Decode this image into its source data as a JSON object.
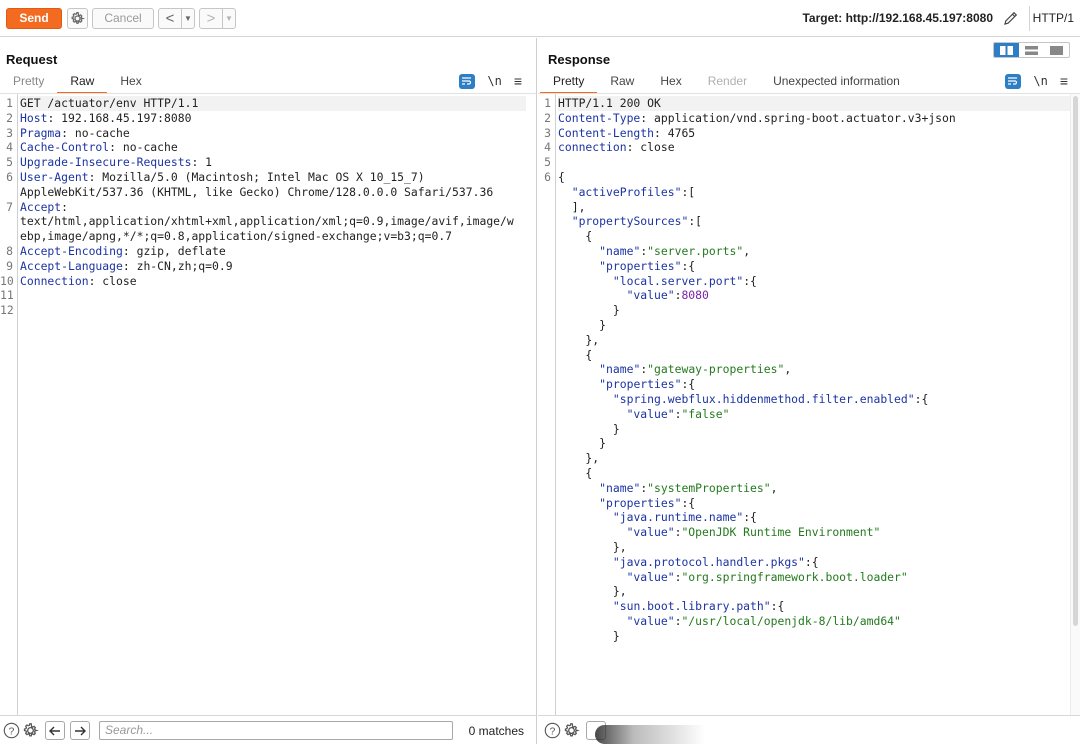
{
  "toolbar": {
    "send_label": "Send",
    "cancel_label": "Cancel",
    "target_label": "Target: http://192.168.45.197:8080",
    "protocol": "HTTP/1",
    "accent_color": "#f26b21"
  },
  "request": {
    "title": "Request",
    "tabs": [
      "Pretty",
      "Raw",
      "Hex"
    ],
    "active_tab": "Raw",
    "search_placeholder": "Search...",
    "matches": "0 matches"
  },
  "response": {
    "title": "Response",
    "tabs": [
      "Pretty",
      "Raw",
      "Hex",
      "Render",
      "Unexpected information"
    ],
    "active_tab": "Pretty"
  },
  "icons": {
    "wrap": "wrap-lines-icon",
    "newline": "\\n",
    "menu": "≡",
    "help": "help-icon",
    "settings": "gear-icon"
  },
  "request_lines": [
    {
      "n": "1",
      "t": "GET /actuator/env HTTP/1.1"
    },
    {
      "n": "2",
      "k": "Host",
      "v": " 192.168.45.197:8080"
    },
    {
      "n": "3",
      "k": "Pragma",
      "v": " no-cache"
    },
    {
      "n": "4",
      "k": "Cache-Control",
      "v": " no-cache"
    },
    {
      "n": "5",
      "k": "Upgrade-Insecure-Requests",
      "v": " 1"
    },
    {
      "n": "6",
      "k": "User-Agent",
      "v": " Mozilla/5.0 (Macintosh; Intel Mac OS X 10_15_7)"
    },
    {
      "n": "",
      "t": "AppleWebKit/537.36 (KHTML, like Gecko) Chrome/128.0.0.0 Safari/537.36"
    },
    {
      "n": "7",
      "k": "Accept",
      "v": ""
    },
    {
      "n": "",
      "t": "text/html,application/xhtml+xml,application/xml;q=0.9,image/avif,image/w"
    },
    {
      "n": "",
      "t": "ebp,image/apng,*/*;q=0.8,application/signed-exchange;v=b3;q=0.7"
    },
    {
      "n": "8",
      "k": "Accept-Encoding",
      "v": " gzip, deflate"
    },
    {
      "n": "9",
      "k": "Accept-Language",
      "v": " zh-CN,zh;q=0.9"
    },
    {
      "n": "10",
      "k": "Connection",
      "v": " close"
    },
    {
      "n": "11",
      "t": ""
    },
    {
      "n": "12",
      "t": ""
    }
  ],
  "response_lines": [
    {
      "n": "1",
      "parts": [
        {
          "c": "pl",
          "s": "HTTP/1.1 200 OK"
        }
      ]
    },
    {
      "n": "2",
      "parts": [
        {
          "c": "hk",
          "s": "Content-Type"
        },
        {
          "c": "pl",
          "s": ": application/vnd.spring-boot.actuator.v3+json"
        }
      ]
    },
    {
      "n": "3",
      "parts": [
        {
          "c": "hk",
          "s": "Content-Length"
        },
        {
          "c": "pl",
          "s": ": 4765"
        }
      ]
    },
    {
      "n": "4",
      "parts": [
        {
          "c": "hk",
          "s": "connection"
        },
        {
          "c": "pl",
          "s": ": close"
        }
      ]
    },
    {
      "n": "5",
      "parts": []
    },
    {
      "n": "6",
      "parts": [
        {
          "c": "pl",
          "s": "{"
        }
      ]
    },
    {
      "n": "",
      "parts": [
        {
          "c": "pl",
          "s": "  "
        },
        {
          "c": "jk",
          "s": "\"activeProfiles\""
        },
        {
          "c": "pl",
          "s": ":["
        }
      ]
    },
    {
      "n": "",
      "parts": [
        {
          "c": "pl",
          "s": "  ],"
        }
      ]
    },
    {
      "n": "",
      "parts": [
        {
          "c": "pl",
          "s": "  "
        },
        {
          "c": "jk",
          "s": "\"propertySources\""
        },
        {
          "c": "pl",
          "s": ":["
        }
      ]
    },
    {
      "n": "",
      "parts": [
        {
          "c": "pl",
          "s": "    {"
        }
      ]
    },
    {
      "n": "",
      "parts": [
        {
          "c": "pl",
          "s": "      "
        },
        {
          "c": "jk",
          "s": "\"name\""
        },
        {
          "c": "pl",
          "s": ":"
        },
        {
          "c": "js",
          "s": "\"server.ports\""
        },
        {
          "c": "pl",
          "s": ","
        }
      ]
    },
    {
      "n": "",
      "parts": [
        {
          "c": "pl",
          "s": "      "
        },
        {
          "c": "jk",
          "s": "\"properties\""
        },
        {
          "c": "pl",
          "s": ":{"
        }
      ]
    },
    {
      "n": "",
      "parts": [
        {
          "c": "pl",
          "s": "        "
        },
        {
          "c": "jk",
          "s": "\"local.server.port\""
        },
        {
          "c": "pl",
          "s": ":{"
        }
      ]
    },
    {
      "n": "",
      "parts": [
        {
          "c": "pl",
          "s": "          "
        },
        {
          "c": "jk",
          "s": "\"value\""
        },
        {
          "c": "pl",
          "s": ":"
        },
        {
          "c": "jn",
          "s": "8080"
        }
      ]
    },
    {
      "n": "",
      "parts": [
        {
          "c": "pl",
          "s": "        }"
        }
      ]
    },
    {
      "n": "",
      "parts": [
        {
          "c": "pl",
          "s": "      }"
        }
      ]
    },
    {
      "n": "",
      "parts": [
        {
          "c": "pl",
          "s": "    },"
        }
      ]
    },
    {
      "n": "",
      "parts": [
        {
          "c": "pl",
          "s": "    {"
        }
      ]
    },
    {
      "n": "",
      "parts": [
        {
          "c": "pl",
          "s": "      "
        },
        {
          "c": "jk",
          "s": "\"name\""
        },
        {
          "c": "pl",
          "s": ":"
        },
        {
          "c": "js",
          "s": "\"gateway-properties\""
        },
        {
          "c": "pl",
          "s": ","
        }
      ]
    },
    {
      "n": "",
      "parts": [
        {
          "c": "pl",
          "s": "      "
        },
        {
          "c": "jk",
          "s": "\"properties\""
        },
        {
          "c": "pl",
          "s": ":{"
        }
      ]
    },
    {
      "n": "",
      "parts": [
        {
          "c": "pl",
          "s": "        "
        },
        {
          "c": "jk",
          "s": "\"spring.webflux.hiddenmethod.filter.enabled\""
        },
        {
          "c": "pl",
          "s": ":{"
        }
      ]
    },
    {
      "n": "",
      "parts": [
        {
          "c": "pl",
          "s": "          "
        },
        {
          "c": "jk",
          "s": "\"value\""
        },
        {
          "c": "pl",
          "s": ":"
        },
        {
          "c": "js",
          "s": "\"false\""
        }
      ]
    },
    {
      "n": "",
      "parts": [
        {
          "c": "pl",
          "s": "        }"
        }
      ]
    },
    {
      "n": "",
      "parts": [
        {
          "c": "pl",
          "s": "      }"
        }
      ]
    },
    {
      "n": "",
      "parts": [
        {
          "c": "pl",
          "s": "    },"
        }
      ]
    },
    {
      "n": "",
      "parts": [
        {
          "c": "pl",
          "s": "    {"
        }
      ]
    },
    {
      "n": "",
      "parts": [
        {
          "c": "pl",
          "s": "      "
        },
        {
          "c": "jk",
          "s": "\"name\""
        },
        {
          "c": "pl",
          "s": ":"
        },
        {
          "c": "js",
          "s": "\"systemProperties\""
        },
        {
          "c": "pl",
          "s": ","
        }
      ]
    },
    {
      "n": "",
      "parts": [
        {
          "c": "pl",
          "s": "      "
        },
        {
          "c": "jk",
          "s": "\"properties\""
        },
        {
          "c": "pl",
          "s": ":{"
        }
      ]
    },
    {
      "n": "",
      "parts": [
        {
          "c": "pl",
          "s": "        "
        },
        {
          "c": "jk",
          "s": "\"java.runtime.name\""
        },
        {
          "c": "pl",
          "s": ":{"
        }
      ]
    },
    {
      "n": "",
      "parts": [
        {
          "c": "pl",
          "s": "          "
        },
        {
          "c": "jk",
          "s": "\"value\""
        },
        {
          "c": "pl",
          "s": ":"
        },
        {
          "c": "js",
          "s": "\"OpenJDK Runtime Environment\""
        }
      ]
    },
    {
      "n": "",
      "parts": [
        {
          "c": "pl",
          "s": "        },"
        }
      ]
    },
    {
      "n": "",
      "parts": [
        {
          "c": "pl",
          "s": "        "
        },
        {
          "c": "jk",
          "s": "\"java.protocol.handler.pkgs\""
        },
        {
          "c": "pl",
          "s": ":{"
        }
      ]
    },
    {
      "n": "",
      "parts": [
        {
          "c": "pl",
          "s": "          "
        },
        {
          "c": "jk",
          "s": "\"value\""
        },
        {
          "c": "pl",
          "s": ":"
        },
        {
          "c": "js",
          "s": "\"org.springframework.boot.loader\""
        }
      ]
    },
    {
      "n": "",
      "parts": [
        {
          "c": "pl",
          "s": "        },"
        }
      ]
    },
    {
      "n": "",
      "parts": [
        {
          "c": "pl",
          "s": "        "
        },
        {
          "c": "jk",
          "s": "\"sun.boot.library.path\""
        },
        {
          "c": "pl",
          "s": ":{"
        }
      ]
    },
    {
      "n": "",
      "parts": [
        {
          "c": "pl",
          "s": "          "
        },
        {
          "c": "jk",
          "s": "\"value\""
        },
        {
          "c": "pl",
          "s": ":"
        },
        {
          "c": "js",
          "s": "\"/usr/local/openjdk-8/lib/amd64\""
        }
      ]
    },
    {
      "n": "",
      "parts": [
        {
          "c": "pl",
          "s": "        }"
        }
      ]
    }
  ]
}
